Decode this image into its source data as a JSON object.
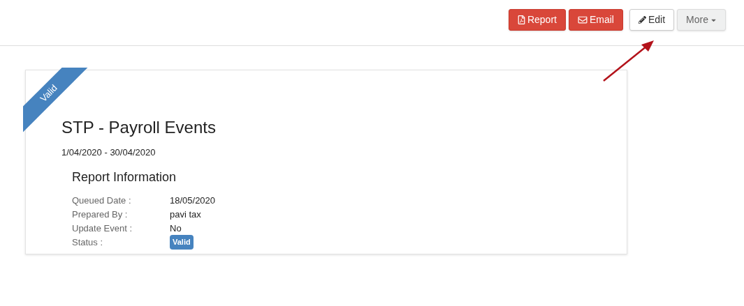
{
  "toolbar": {
    "buttons": [
      {
        "label": "Report",
        "kind": "danger"
      },
      {
        "label": "Email",
        "kind": "danger"
      },
      {
        "label": "Edit",
        "kind": "default"
      },
      {
        "label": "More",
        "kind": "dropdown"
      }
    ]
  },
  "card": {
    "ribbon": "Valid",
    "title": "STP - Payroll Events",
    "period": "1/04/2020 - 30/04/2020",
    "section_title": "Report Information",
    "fields": [
      {
        "label": "Queued Date :",
        "value": "18/05/2020",
        "kind": "text"
      },
      {
        "label": "Prepared By :",
        "value": "pavi tax",
        "kind": "text"
      },
      {
        "label": "Update Event :",
        "value": "No",
        "kind": "text"
      },
      {
        "label": "Status :",
        "value": "Valid",
        "kind": "badge"
      }
    ]
  }
}
